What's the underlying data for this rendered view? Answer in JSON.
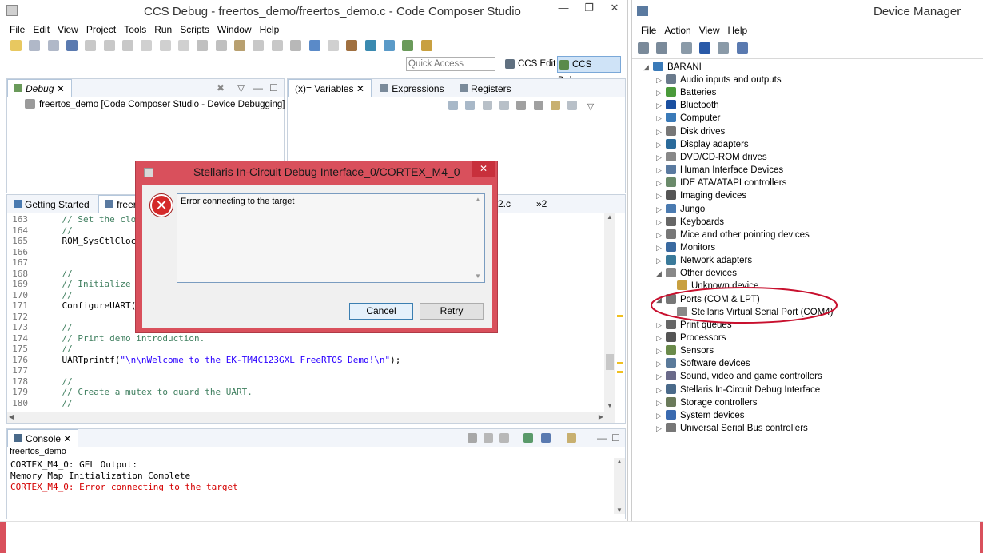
{
  "ccs": {
    "title": "CCS Debug - freertos_demo/freertos_demo.c - Code Composer Studio",
    "window_controls": [
      "—",
      "❐",
      "✕"
    ],
    "menu": [
      "File",
      "Edit",
      "View",
      "Project",
      "Tools",
      "Run",
      "Scripts",
      "Window",
      "Help"
    ],
    "quick_access_placeholder": "Quick Access",
    "perspectives": [
      "CCS Edit",
      "CCS Debug"
    ],
    "debug_view": {
      "tab": "Debug",
      "item": "freertos_demo [Code Composer Studio - Device Debugging]"
    },
    "variables_view": {
      "tabs": [
        "(x)= Variables",
        "Expressions",
        "Registers"
      ]
    },
    "editor": {
      "tabs": [
        "Getting Started",
        "freer",
        "2.c",
        "»2"
      ],
      "lines": [
        {
          "n": "163",
          "text": "    // Set the clock",
          "type": "comment"
        },
        {
          "n": "164",
          "text": "    //",
          "type": "comment"
        },
        {
          "n": "165",
          "text": "    ROM_SysCtlClockS",
          "type": "code"
        },
        {
          "n": "166",
          "text": "",
          "type": "code"
        },
        {
          "n": "167",
          "text": "",
          "type": "code"
        },
        {
          "n": "168",
          "text": "    //",
          "type": "comment"
        },
        {
          "n": "169",
          "text": "    // Initialize th",
          "type": "comment"
        },
        {
          "n": "170",
          "text": "    //",
          "type": "comment"
        },
        {
          "n": "171",
          "text": "    ConfigureUART();",
          "type": "code"
        },
        {
          "n": "172",
          "text": "",
          "type": "code"
        },
        {
          "n": "173",
          "text": "    //",
          "type": "comment"
        },
        {
          "n": "174",
          "text": "    // Print demo introduction.",
          "type": "comment"
        },
        {
          "n": "175",
          "text": "    //",
          "type": "comment"
        },
        {
          "n": "176",
          "pre": "    UARTprintf(",
          "str": "\"\\n\\nWelcome to the EK-TM4C123GXL FreeRTOS Demo!\\n\"",
          "post": ");",
          "type": "call"
        },
        {
          "n": "177",
          "text": "",
          "type": "code"
        },
        {
          "n": "178",
          "text": "    //",
          "type": "comment"
        },
        {
          "n": "179",
          "text": "    // Create a mutex to guard the UART.",
          "type": "comment"
        },
        {
          "n": "180",
          "text": "    //",
          "type": "comment"
        }
      ]
    },
    "console": {
      "tab": "Console",
      "session": "freertos_demo",
      "lines": [
        {
          "text": "CORTEX_M4_0: GEL Output:",
          "color": "#000000"
        },
        {
          "text": "Memory Map Initialization Complete",
          "color": "#000000"
        },
        {
          "text": "CORTEX_M4_0: Error connecting to the target",
          "color": "#d40000"
        }
      ]
    }
  },
  "dialog": {
    "title": "Stellaris In-Circuit Debug Interface_0/CORTEX_M4_0",
    "close": "✕",
    "message": "Error connecting to the target",
    "cancel_label": "Cancel",
    "retry_label": "Retry",
    "accent": "#d9505c"
  },
  "device_manager": {
    "title": "Device Manager",
    "menu": [
      "File",
      "Action",
      "View",
      "Help"
    ],
    "root": "BARANI",
    "items": [
      {
        "label": "Audio inputs and outputs",
        "arrow": "▷",
        "icon": "#6a7a8c"
      },
      {
        "label": "Batteries",
        "arrow": "▷",
        "icon": "#4a9a3a"
      },
      {
        "label": "Bluetooth",
        "arrow": "▷",
        "icon": "#1a4fa0"
      },
      {
        "label": "Computer",
        "arrow": "▷",
        "icon": "#3a7ab8"
      },
      {
        "label": "Disk drives",
        "arrow": "▷",
        "icon": "#777777"
      },
      {
        "label": "Display adapters",
        "arrow": "▷",
        "icon": "#2a6a9a"
      },
      {
        "label": "DVD/CD-ROM drives",
        "arrow": "▷",
        "icon": "#888888"
      },
      {
        "label": "Human Interface Devices",
        "arrow": "▷",
        "icon": "#5a7aa0"
      },
      {
        "label": "IDE ATA/ATAPI controllers",
        "arrow": "▷",
        "icon": "#6a8a6a"
      },
      {
        "label": "Imaging devices",
        "arrow": "▷",
        "icon": "#555555"
      },
      {
        "label": "Jungo",
        "arrow": "▷",
        "icon": "#4a7ab0"
      },
      {
        "label": "Keyboards",
        "arrow": "▷",
        "icon": "#666666"
      },
      {
        "label": "Mice and other pointing devices",
        "arrow": "▷",
        "icon": "#777777"
      },
      {
        "label": "Monitors",
        "arrow": "▷",
        "icon": "#3a6aa0"
      },
      {
        "label": "Network adapters",
        "arrow": "▷",
        "icon": "#3a7a9a"
      },
      {
        "label": "Other devices",
        "arrow": "◢",
        "icon": "#888888"
      },
      {
        "label": "Unknown device",
        "arrow": "",
        "icon": "#c8a040",
        "indent": 1
      },
      {
        "label": "Ports (COM & LPT)",
        "arrow": "◢",
        "icon": "#777777"
      },
      {
        "label": "Stellaris Virtual Serial Port (COM4)",
        "arrow": "",
        "icon": "#888888",
        "indent": 1
      },
      {
        "label": "Print queues",
        "arrow": "▷",
        "icon": "#666666"
      },
      {
        "label": "Processors",
        "arrow": "▷",
        "icon": "#555555"
      },
      {
        "label": "Sensors",
        "arrow": "▷",
        "icon": "#6a8a4a"
      },
      {
        "label": "Software devices",
        "arrow": "▷",
        "icon": "#5a7a9a"
      },
      {
        "label": "Sound, video and game controllers",
        "arrow": "▷",
        "icon": "#6a6a8a"
      },
      {
        "label": "Stellaris In-Circuit Debug Interface",
        "arrow": "▷",
        "icon": "#4a6a8a"
      },
      {
        "label": "Storage controllers",
        "arrow": "▷",
        "icon": "#6a7a5a"
      },
      {
        "label": "System devices",
        "arrow": "▷",
        "icon": "#3a6ab0"
      },
      {
        "label": "Universal Serial Bus controllers",
        "arrow": "▷",
        "icon": "#777777"
      }
    ],
    "highlight_color": "#c8102e"
  }
}
